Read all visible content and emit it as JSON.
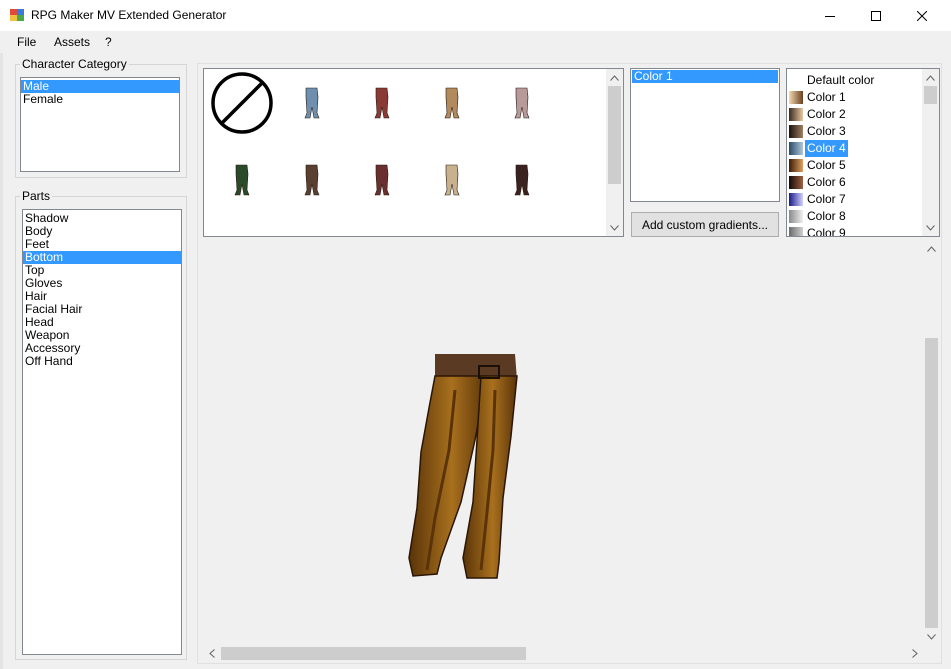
{
  "window": {
    "title": "RPG Maker MV Extended Generator",
    "icon": "app-icon"
  },
  "menu": [
    "File",
    "Assets",
    "?"
  ],
  "character_category": {
    "caption": "Character Category",
    "items": [
      "Male",
      "Female"
    ],
    "selected": "Male"
  },
  "parts": {
    "caption": "Parts",
    "items": [
      "Shadow",
      "Body",
      "Feet",
      "Bottom",
      "Top",
      "Gloves",
      "Hair",
      "Facial Hair",
      "Head",
      "Weapon",
      "Accessory",
      "Off Hand"
    ],
    "selected": "Bottom"
  },
  "assets": [
    {
      "name": "none-icon",
      "color": "#000000"
    },
    {
      "name": "pants-blue",
      "color": "#6f8fb0"
    },
    {
      "name": "pants-red",
      "color": "#8a3a35"
    },
    {
      "name": "pants-tan",
      "color": "#b28a5e"
    },
    {
      "name": "pants-pink-grey",
      "color": "#b89a9a"
    },
    {
      "name": "pants-green",
      "color": "#2a4a2a"
    },
    {
      "name": "pants-brown",
      "color": "#5a4030"
    },
    {
      "name": "pants-maroon",
      "color": "#6a3030"
    },
    {
      "name": "pants-beige",
      "color": "#c8b28e"
    },
    {
      "name": "pants-dark",
      "color": "#3a2220"
    }
  ],
  "layers": {
    "items": [
      "Color 1"
    ],
    "selected": "Color 1"
  },
  "add_gradients_label": "Add custom gradients...",
  "colors": {
    "items": [
      {
        "label": "Default color",
        "swatch": ""
      },
      {
        "label": "Color 1",
        "swatch": "linear-gradient(90deg,#f2d9b0,#6a4020)"
      },
      {
        "label": "Color 2",
        "swatch": "linear-gradient(90deg,#3a2a20,#e8c8a0)"
      },
      {
        "label": "Color 3",
        "swatch": "linear-gradient(90deg,#1a1010,#a08060)"
      },
      {
        "label": "Color 4",
        "swatch": "linear-gradient(90deg,#2a4a6a,#b0c8d8)"
      },
      {
        "label": "Color 5",
        "swatch": "linear-gradient(90deg,#3a1a08,#e0a060)"
      },
      {
        "label": "Color 6",
        "swatch": "linear-gradient(90deg,#100808,#a06040)"
      },
      {
        "label": "Color 7",
        "swatch": "linear-gradient(90deg,#1a1a8a,#d0d0ff)"
      },
      {
        "label": "Color 8",
        "swatch": "linear-gradient(90deg,#8a8a8a,#f0f0f0)"
      },
      {
        "label": "Color 9",
        "swatch": "linear-gradient(90deg,#6a6a6a,#d0d0d0)"
      }
    ],
    "selected": "Color 4"
  },
  "preview": {
    "pants_color": "#a8701e",
    "pants_shadow": "#5a3408",
    "belt_color": "#5a3a22"
  }
}
